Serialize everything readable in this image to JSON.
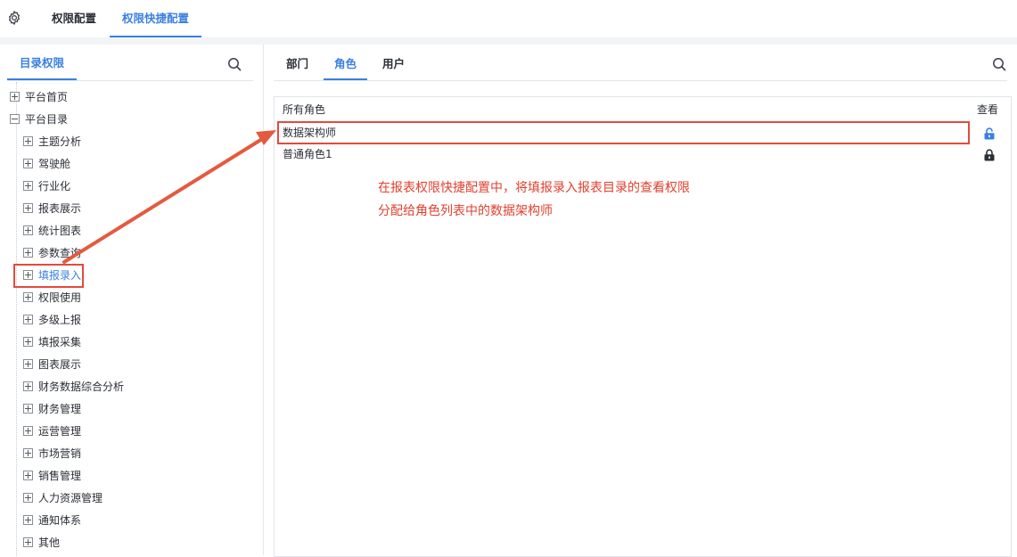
{
  "header": {
    "tabs": [
      {
        "label": "权限配置",
        "active": false
      },
      {
        "label": "权限快捷配置",
        "active": true
      }
    ],
    "settings_icon": "gear-icon"
  },
  "left_panel": {
    "tab_label": "目录权限",
    "search_icon": "search-icon",
    "tree": {
      "root_items": [
        {
          "label": "平台首页",
          "expanded": false
        },
        {
          "label": "平台目录",
          "expanded": true
        }
      ],
      "children": [
        {
          "label": "主题分析"
        },
        {
          "label": "驾驶舱"
        },
        {
          "label": "行业化"
        },
        {
          "label": "报表展示"
        },
        {
          "label": "统计图表"
        },
        {
          "label": "参数查询"
        },
        {
          "label": "填报录入",
          "selected": true
        },
        {
          "label": "权限使用"
        },
        {
          "label": "多级上报"
        },
        {
          "label": "填报采集"
        },
        {
          "label": "图表展示"
        },
        {
          "label": "财务数据综合分析"
        },
        {
          "label": "财务管理"
        },
        {
          "label": "运营管理"
        },
        {
          "label": "市场营销"
        },
        {
          "label": "销售管理"
        },
        {
          "label": "人力资源管理"
        },
        {
          "label": "通知体系"
        },
        {
          "label": "其他"
        }
      ]
    }
  },
  "right_panel": {
    "tabs": [
      {
        "label": "部门",
        "active": false
      },
      {
        "label": "角色",
        "active": true
      },
      {
        "label": "用户",
        "active": false
      }
    ],
    "search_icon": "search-icon",
    "table": {
      "header_name": "所有角色",
      "header_view": "查看",
      "rows": [
        {
          "name": "数据架构师",
          "view_state": "unlocked",
          "highlighted": true
        },
        {
          "name": "普通角色1",
          "view_state": "locked",
          "highlighted": false
        }
      ]
    }
  },
  "annotation": {
    "line1": "在报表权限快捷配置中，将填报录入报表目录的查看权限",
    "line2": "分配给角色列表中的数据架构师",
    "color": "#e2402f"
  },
  "colors": {
    "accent": "#3a80e0",
    "unlocked_icon": "#3a80e0",
    "locked_icon": "#2b2f36",
    "annotation": "#e24b3d"
  }
}
